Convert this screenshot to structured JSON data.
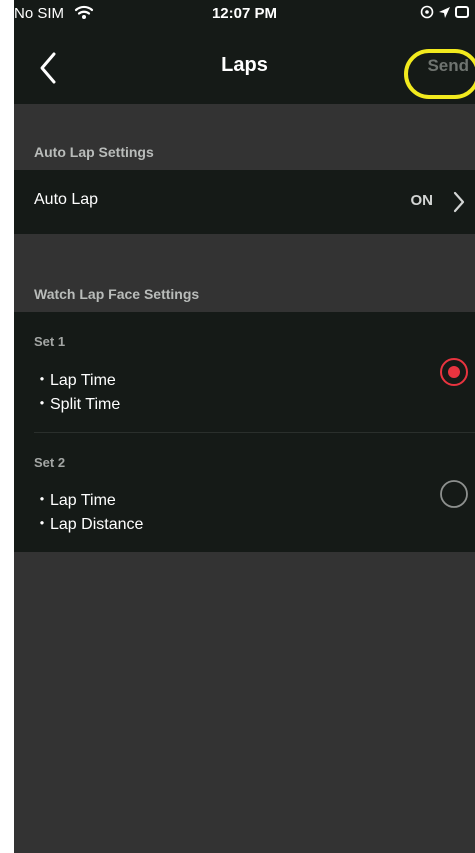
{
  "status_bar": {
    "carrier": "No SIM",
    "time": "12:07 PM"
  },
  "nav": {
    "title": "Laps",
    "send_label": "Send"
  },
  "auto_lap_section": {
    "header": "Auto Lap Settings",
    "row_label": "Auto Lap",
    "row_value": "ON"
  },
  "lap_face_section": {
    "header": "Watch Lap Face Settings",
    "sets": [
      {
        "title": "Set 1",
        "items": [
          "・Lap Time",
          "・Split Time"
        ],
        "selected": true
      },
      {
        "title": "Set 2",
        "items": [
          "・Lap Time",
          "・Lap Distance"
        ],
        "selected": false
      }
    ]
  },
  "colors": {
    "accent_red": "#e8343f",
    "highlight_yellow": "#f2ea1e",
    "background": "#333333",
    "row_background": "#151a17"
  }
}
